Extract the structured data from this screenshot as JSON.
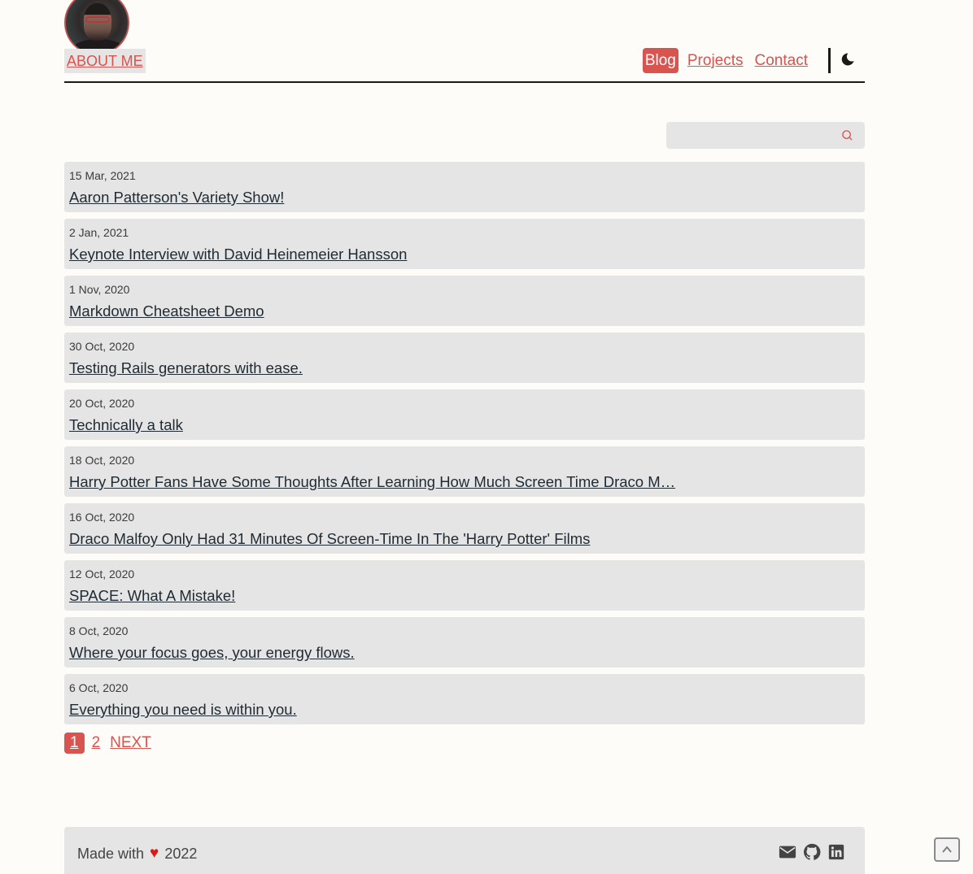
{
  "header": {
    "about_label": "ABOUT ME",
    "nav": [
      {
        "label": "Blog",
        "active": true
      },
      {
        "label": "Projects",
        "active": false
      },
      {
        "label": "Contact",
        "active": false
      }
    ],
    "theme_toggle_icon": "moon-icon"
  },
  "search": {
    "placeholder": "",
    "icon": "search-icon"
  },
  "posts": [
    {
      "date": "15 Mar, 2021",
      "title": "Aaron Patterson's Variety Show!"
    },
    {
      "date": "2 Jan, 2021",
      "title": "Keynote Interview with David Heinemeier Hansson"
    },
    {
      "date": "1 Nov, 2020",
      "title": "Markdown Cheatsheet Demo"
    },
    {
      "date": "30 Oct, 2020",
      "title": "Testing Rails generators with ease."
    },
    {
      "date": "20 Oct, 2020",
      "title": "Technically a talk"
    },
    {
      "date": "18 Oct, 2020",
      "title": "Harry Potter Fans Have Some Thoughts After Learning How Much Screen Time Draco M…"
    },
    {
      "date": "16 Oct, 2020",
      "title": "Draco Malfoy Only Had 31 Minutes Of Screen-Time In The 'Harry Potter' Films"
    },
    {
      "date": "12 Oct, 2020",
      "title": "SPACE: What A Mistake!"
    },
    {
      "date": "8 Oct, 2020",
      "title": "Where your focus goes, your energy flows."
    },
    {
      "date": "6 Oct, 2020",
      "title": "Everything you need is within you."
    }
  ],
  "pagination": {
    "current": "1",
    "page2": "2",
    "next": "NEXT"
  },
  "footer": {
    "made_with": "Made with",
    "heart": "♥",
    "year": "2022",
    "icons": [
      "email-icon",
      "github-icon",
      "linkedin-icon"
    ]
  },
  "colors": {
    "accent": "#d9534f",
    "background": "#fdfcf8",
    "card": "#e5e5e5"
  }
}
